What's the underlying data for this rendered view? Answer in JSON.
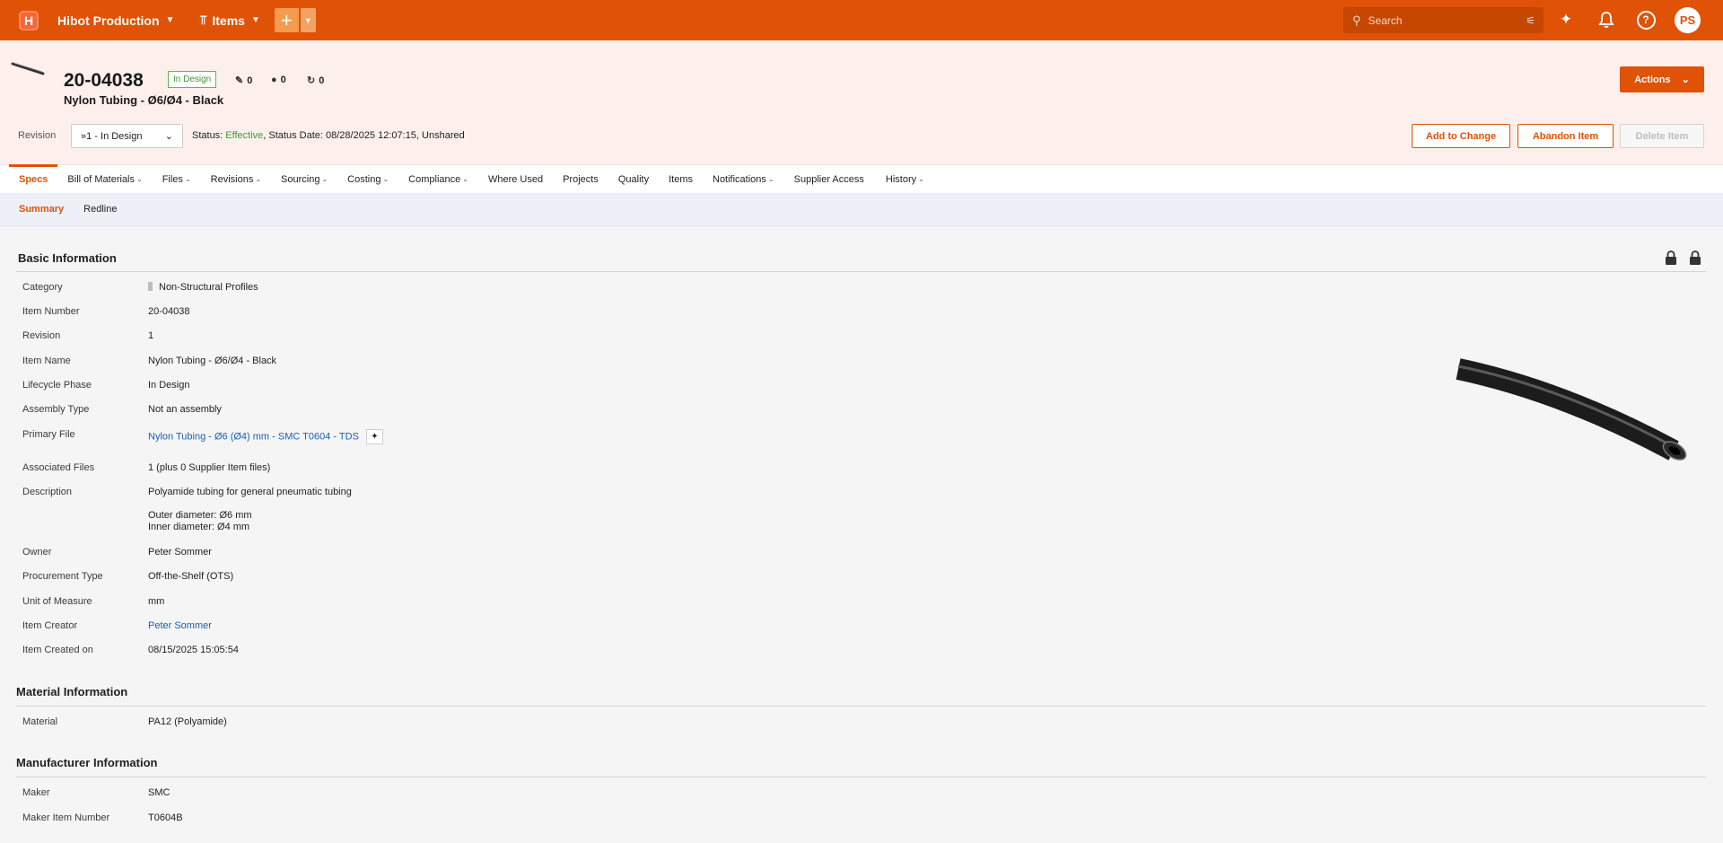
{
  "topbar": {
    "logo_letter": "H",
    "workspace": "Hibot Production",
    "items_menu": "Items",
    "search_placeholder": "Search",
    "avatar_initials": "PS",
    "brand_color": "#e05206"
  },
  "header": {
    "item_number": "20-04038",
    "status_badge": "In Design",
    "counters": {
      "changes": "0",
      "users": "0",
      "workflows": "0"
    },
    "item_title": "Nylon Tubing - Ø6/Ø4 - Black",
    "actions_label": "Actions",
    "revision_label": "Revision",
    "revision_value": "»1 - In Design",
    "status_prefix": "Status: ",
    "status_value": "Effective",
    "status_suffix": ", Status Date: 08/28/2025 12:07:15, Unshared",
    "buttons": {
      "add_to_change": "Add to Change",
      "abandon_item": "Abandon Item",
      "delete_item": "Delete Item"
    }
  },
  "tabs": [
    {
      "label": "Specs",
      "has_menu": false
    },
    {
      "label": "Bill of Materials",
      "has_menu": true
    },
    {
      "label": "Files",
      "has_menu": true
    },
    {
      "label": "Revisions",
      "has_menu": true
    },
    {
      "label": "Sourcing",
      "has_menu": true
    },
    {
      "label": "Costing",
      "has_menu": true
    },
    {
      "label": "Compliance",
      "has_menu": true
    },
    {
      "label": "Where Used",
      "has_menu": false
    },
    {
      "label": "Projects",
      "has_menu": false
    },
    {
      "label": "Quality",
      "has_menu": false
    },
    {
      "label": "Items",
      "has_menu": false
    },
    {
      "label": "Notifications",
      "has_menu": true
    },
    {
      "label": "Supplier Access",
      "has_menu": false
    },
    {
      "label": "History",
      "has_menu": true
    }
  ],
  "subtabs": [
    "Summary",
    "Redline"
  ],
  "basic": {
    "title": "Basic Information",
    "rows": {
      "category": {
        "label": "Category",
        "value": "Non-Structural Profiles"
      },
      "item_number": {
        "label": "Item Number",
        "value": "20-04038"
      },
      "revision": {
        "label": "Revision",
        "value": "1"
      },
      "item_name": {
        "label": "Item Name",
        "value": "Nylon Tubing - Ø6/Ø4 - Black"
      },
      "lifecycle": {
        "label": "Lifecycle Phase",
        "value": "In Design"
      },
      "assembly": {
        "label": "Assembly Type",
        "value": "Not an assembly"
      },
      "primary_file": {
        "label": "Primary File",
        "value": "Nylon Tubing - Ø6 (Ø4) mm - SMC T0604 - TDS"
      },
      "assoc_files": {
        "label": "Associated Files",
        "value": "1 (plus 0 Supplier Item files)"
      },
      "description": {
        "label": "Description",
        "line1": "Polyamide tubing for general pneumatic tubing",
        "line2": "Outer diameter: Ø6 mm",
        "line3": "Inner diameter: Ø4 mm"
      },
      "owner": {
        "label": "Owner",
        "value": "Peter Sommer"
      },
      "procurement": {
        "label": "Procurement Type",
        "value": "Off-the-Shelf (OTS)"
      },
      "uom": {
        "label": "Unit of Measure",
        "value": "mm"
      },
      "creator": {
        "label": "Item Creator",
        "value": "Peter Sommer"
      },
      "created_on": {
        "label": "Item Created on",
        "value": "08/15/2025 15:05:54"
      }
    }
  },
  "material": {
    "title": "Material Information",
    "rows": {
      "material": {
        "label": "Material",
        "value": "PA12 (Polyamide)"
      }
    }
  },
  "manufacturer": {
    "title": "Manufacturer Information",
    "rows": {
      "maker": {
        "label": "Maker",
        "value": "SMC"
      },
      "maker_item": {
        "label": "Maker Item Number",
        "value": "T0604B"
      }
    }
  }
}
